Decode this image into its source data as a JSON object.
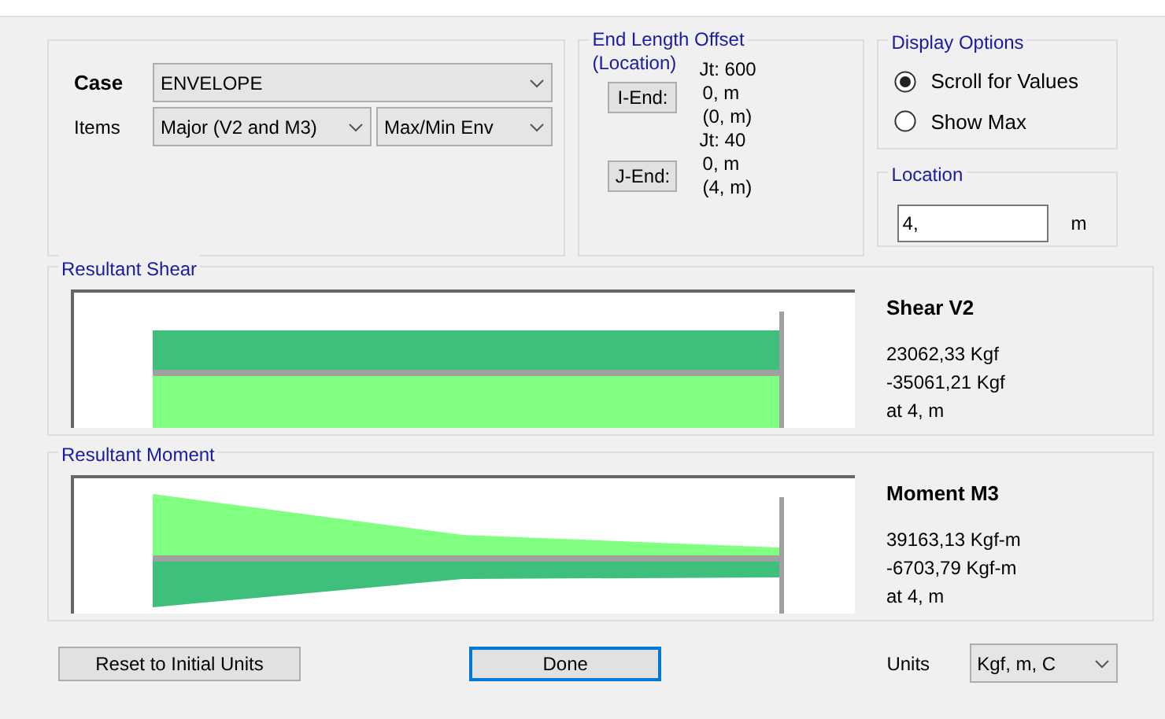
{
  "case": {
    "label": "Case",
    "value": "ENVELOPE"
  },
  "items": {
    "label": "Items",
    "component": "Major (V2 and M3)",
    "type": "Max/Min Env"
  },
  "end_length_offset": {
    "title": "End Length Offset",
    "subtitle": "(Location)",
    "ends": [
      {
        "button": "I-End:",
        "joint": "Jt:  600",
        "offset": "0, m",
        "location": "(0, m)"
      },
      {
        "button": "J-End:",
        "joint": "Jt:  40",
        "offset": "0, m",
        "location": "(4, m)"
      }
    ]
  },
  "display_options": {
    "title": "Display Options",
    "options": [
      {
        "label": "Scroll for Values",
        "selected": true
      },
      {
        "label": "Show Max",
        "selected": false
      }
    ]
  },
  "location": {
    "title": "Location",
    "value": "4,",
    "unit": "m"
  },
  "panels": [
    {
      "kind": "shear",
      "title": "Resultant Shear",
      "heading": "Shear V2",
      "max": "23062,33 Kgf",
      "min": "-35061,21 Kgf",
      "at": "at 4, m"
    },
    {
      "kind": "moment",
      "title": "Resultant Moment",
      "heading": "Moment M3",
      "max": "39163,13 Kgf-m",
      "min": "-6703,79 Kgf-m",
      "at": "at 4, m"
    }
  ],
  "buttons": {
    "reset": "Reset to Initial Units",
    "done": "Done"
  },
  "units": {
    "label": "Units",
    "value": "Kgf, m, C"
  }
}
